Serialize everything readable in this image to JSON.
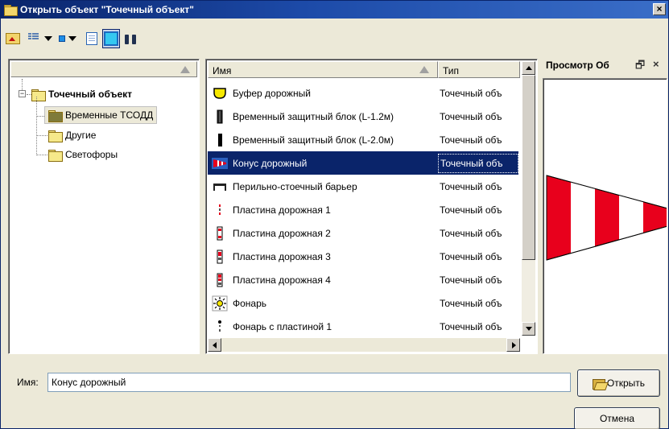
{
  "window": {
    "title": "Открыть объект \"Точечный объект\"",
    "close_glyph": "×"
  },
  "toolbar": {
    "buttons": [
      {
        "icon": "folder-up-icon"
      },
      {
        "icon": "list-view-icon"
      },
      {
        "icon": "small-icons-icon"
      },
      {
        "icon": "description-icon"
      },
      {
        "icon": "preview-icon"
      },
      {
        "icon": "binoculars-icon"
      }
    ]
  },
  "tree": {
    "root": {
      "label": "Точечный объект",
      "expander": "−"
    },
    "children": [
      {
        "label": "Временные ТСОДД",
        "selected": true
      },
      {
        "label": "Другие"
      },
      {
        "label": "Светофоры"
      }
    ]
  },
  "list": {
    "columns": {
      "name": "Имя",
      "type": "Тип"
    },
    "rows": [
      {
        "name": "Буфер дорожный",
        "type": "Точечный объ",
        "icon": "road-buffer-icon"
      },
      {
        "name": "Временный защитный блок (L-1.2м)",
        "type": "Точечный объ",
        "icon": "protective-block-short-icon"
      },
      {
        "name": "Временный защитный блок (L-2.0м)",
        "type": "Точечный объ",
        "icon": "protective-block-long-icon"
      },
      {
        "name": "Конус дорожный",
        "type": "Точечный объ",
        "icon": "traffic-cone-icon",
        "selected": true
      },
      {
        "name": "Перильно-стоечный барьер",
        "type": "Точечный объ",
        "icon": "railing-barrier-icon"
      },
      {
        "name": "Пластина дорожная 1",
        "type": "Точечный объ",
        "icon": "road-plate-1-icon"
      },
      {
        "name": "Пластина дорожная 2",
        "type": "Точечный объ",
        "icon": "road-plate-2-icon"
      },
      {
        "name": "Пластина дорожная 3",
        "type": "Точечный объ",
        "icon": "road-plate-3-icon"
      },
      {
        "name": "Пластина дорожная 4",
        "type": "Точечный объ",
        "icon": "road-plate-4-icon"
      },
      {
        "name": "Фонарь",
        "type": "Точечный объ",
        "icon": "lantern-icon"
      },
      {
        "name": "Фонарь с пластиной 1",
        "type": "Точечный объ",
        "icon": "lantern-plate-icon"
      }
    ]
  },
  "preview": {
    "title": "Просмотр Об",
    "restore_glyph": "🗗",
    "close_glyph": "×",
    "icon": "traffic-cone-preview"
  },
  "form": {
    "name_label": "Имя:",
    "name_value": "Конус дорожный",
    "open_label": "Открыть",
    "cancel_label": "Отмена"
  },
  "colors": {
    "selection": "#0a246a",
    "cone_red": "#e8001c",
    "title_bar": "#0a246a"
  }
}
